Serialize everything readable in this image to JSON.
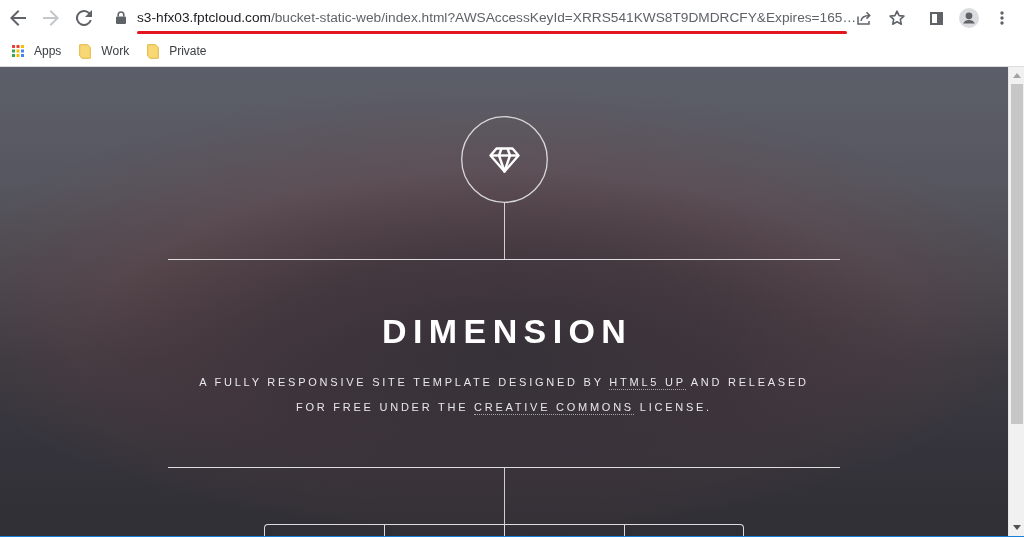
{
  "browser": {
    "nav_buttons": [
      {
        "kind": "back",
        "disabled": false
      },
      {
        "kind": "forward",
        "disabled": true
      },
      {
        "kind": "reload",
        "disabled": false
      }
    ],
    "address": {
      "host": "s3-hfx03.fptcloud.com",
      "path": "/bucket-static-web/index.html?AWSAccessKeyId=XRRS541KWS8T9DMDRCFY&Expires=165…"
    },
    "bookmarks": [
      {
        "kind": "apps",
        "label": "Apps"
      },
      {
        "kind": "folder",
        "label": "Work"
      },
      {
        "kind": "folder",
        "label": "Private"
      }
    ]
  },
  "page": {
    "title": "DIMENSION",
    "description": [
      [
        {
          "kind": "text",
          "text": "A FULLY RESPONSIVE SITE TEMPLATE DESIGNED BY "
        },
        {
          "kind": "link",
          "text": "HTML5 UP"
        },
        {
          "kind": "text",
          "text": " AND RELEASED"
        }
      ],
      [
        {
          "kind": "text",
          "text": "FOR FREE UNDER THE "
        },
        {
          "kind": "link",
          "text": "CREATIVE COMMONS"
        },
        {
          "kind": "text",
          "text": " LICENSE."
        }
      ]
    ]
  }
}
